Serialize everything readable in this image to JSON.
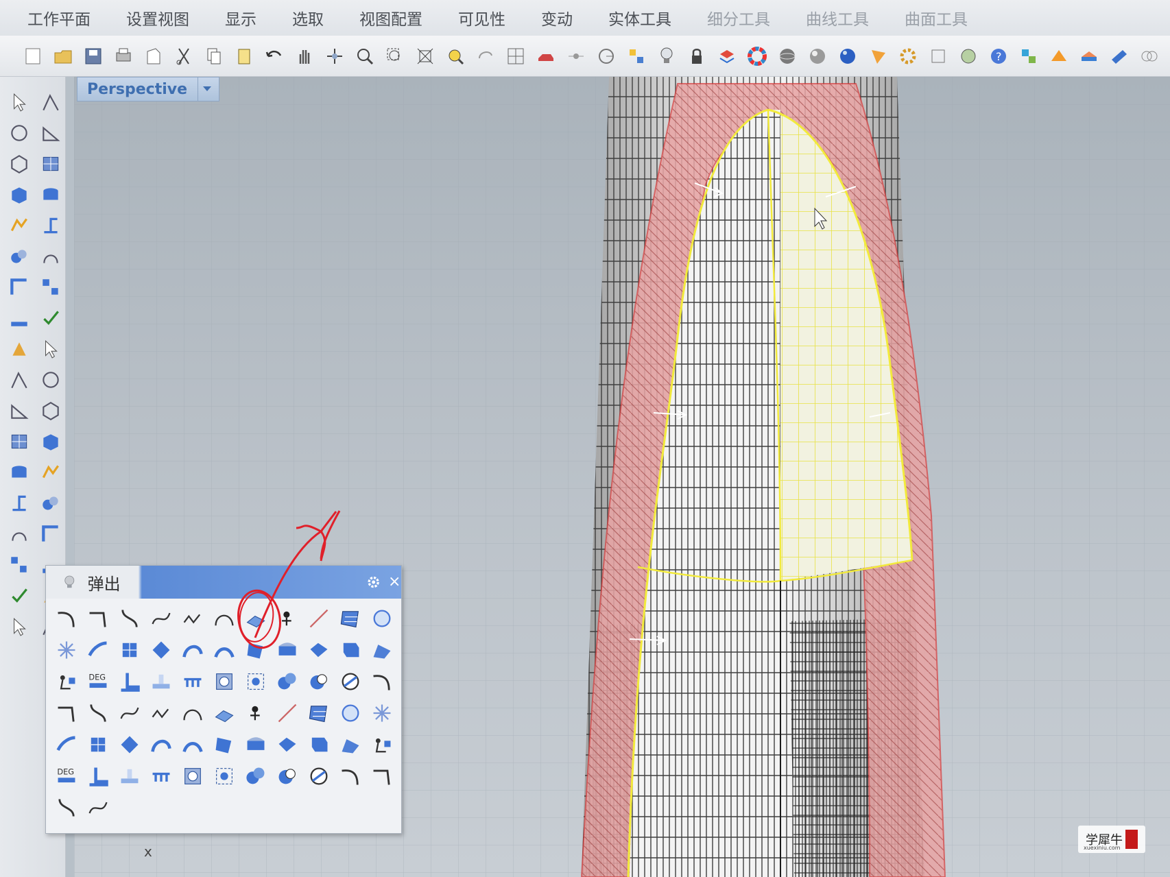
{
  "menu": {
    "items": [
      "工作平面",
      "设置视图",
      "显示",
      "选取",
      "视图配置",
      "可见性",
      "变动",
      "实体工具",
      "细分工具",
      "曲线工具",
      "曲面工具"
    ]
  },
  "toolbar": {
    "icons": [
      "new-file-icon",
      "open-folder-icon",
      "save-icon",
      "print-icon",
      "import-icon",
      "cut-icon",
      "copy-icon",
      "paste-icon",
      "undo-icon",
      "pan-hand-icon",
      "rotate-view-icon",
      "zoom-icon",
      "zoom-window-icon",
      "zoom-extents-icon",
      "zoom-selected-icon",
      "undo-view-icon",
      "four-viewports-icon",
      "car-icon",
      "snap-icon",
      "circle-target-icon",
      "grid-icon",
      "light-bulb-icon",
      "lock-icon",
      "layer-icon",
      "color-wheel-icon",
      "shaded-sphere-icon",
      "rendered-sphere-icon",
      "blue-sphere-icon",
      "material-icon",
      "gear-tool-icon",
      "options-icon",
      "analysis-icon",
      "help-icon",
      "dimension-icon",
      "sun-icon",
      "bridge-icon",
      "plane-icon",
      "object-icon"
    ]
  },
  "viewport": {
    "title": "Perspective",
    "axis_label": "x"
  },
  "popup": {
    "title": "弹出",
    "close": "×"
  },
  "watermark": {
    "text": "学犀牛",
    "sub": "xuexiniu.com"
  },
  "colors": {
    "accent": "#3f6fb0",
    "popup_header": "#5b8ad6",
    "selection": "#f2ea3c",
    "surface_highlight": "#e9a0a0",
    "annotation": "#e0202a"
  }
}
